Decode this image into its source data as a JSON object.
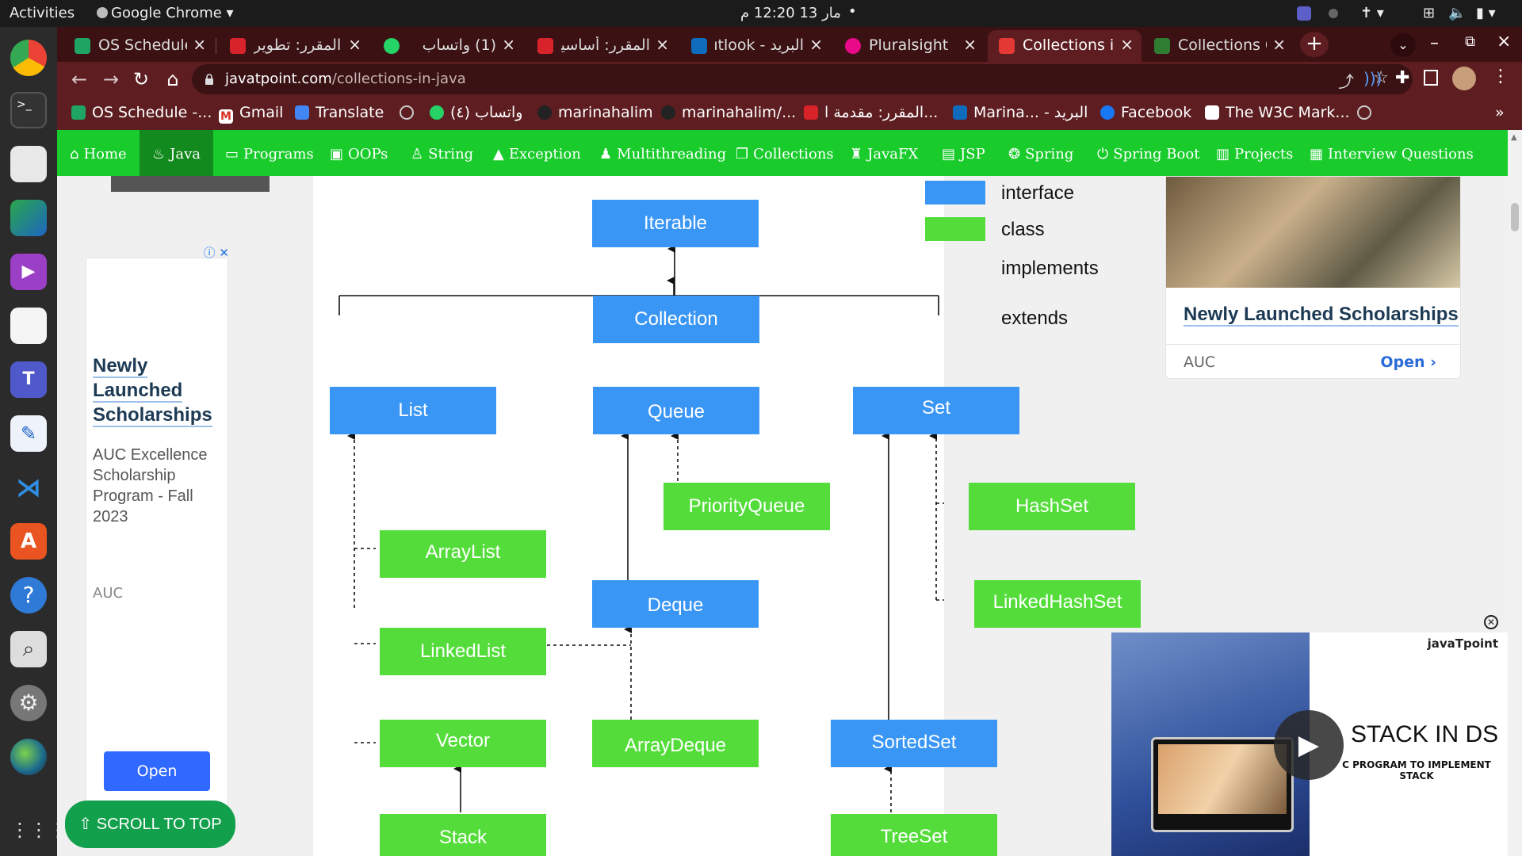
{
  "system": {
    "activities": "Activities",
    "app_name": "Google Chrome",
    "clock": "مار 13  12:20 م"
  },
  "browser": {
    "tabs": [
      {
        "title": "OS Schedule",
        "fav_color": "#1fa463"
      },
      {
        "title": "المقرر: تطوير",
        "fav_color": "#d8232a"
      },
      {
        "title": "(1) واتساب",
        "fav_color": "#25d366"
      },
      {
        "title": "المقرر: أساسيا",
        "fav_color": "#d8232a"
      },
      {
        "title": "البريد - Outlook",
        "fav_color": "#0f6cbd"
      },
      {
        "title": "Pluralsight",
        "fav_color": "#e80a89"
      },
      {
        "title": "Collections in",
        "fav_color": "#e53935"
      },
      {
        "title": "Collections Cl",
        "fav_color": "#2e7d32"
      }
    ],
    "new_tab_icon": "plus-icon",
    "url_domain": "javatpoint.com",
    "url_path": "/collections-in-java",
    "bookmarks": [
      "OS Schedule -...",
      "Gmail",
      "Translate",
      "",
      "واتساب (٤)",
      "marinahalim",
      "marinahalim/...",
      "المقرر: مقدمة ا...",
      "Marina... - البريد",
      "Facebook",
      "The W3C Mark..."
    ],
    "overflow": "»"
  },
  "site_nav": [
    {
      "label": "Home",
      "icon": "home-icon"
    },
    {
      "label": "Java",
      "icon": "java-icon"
    },
    {
      "label": "Programs",
      "icon": "monitor-icon"
    },
    {
      "label": "OOPs",
      "icon": "box-icon"
    },
    {
      "label": "String",
      "icon": "string-icon"
    },
    {
      "label": "Exception",
      "icon": "warning-icon"
    },
    {
      "label": "Multithreading",
      "icon": "thread-icon"
    },
    {
      "label": "Collections",
      "icon": "copy-icon"
    },
    {
      "label": "JavaFX",
      "icon": "fx-icon"
    },
    {
      "label": "JSP",
      "icon": "jsp-icon"
    },
    {
      "label": "Spring",
      "icon": "leaf-icon"
    },
    {
      "label": "Spring Boot",
      "icon": "power-icon"
    },
    {
      "label": "Projects",
      "icon": "folder-icon"
    },
    {
      "label": "Interview Questions",
      "icon": "question-icon"
    }
  ],
  "diagram": {
    "colors": {
      "interface": "#3a96f5",
      "class": "#54dd3a"
    },
    "legend": {
      "interface": "interface",
      "class": "class",
      "implements": "implements",
      "extends": "extends"
    },
    "nodes": {
      "iterable": "Iterable",
      "collection": "Collection",
      "list": "List",
      "queue": "Queue",
      "set": "Set",
      "priorityqueue": "PriorityQueue",
      "hashset": "HashSet",
      "arraylist": "ArrayList",
      "deque": "Deque",
      "linkedhashset": "LinkedHashSet",
      "linkedlist": "LinkedList",
      "vector": "Vector",
      "arraydeque": "ArrayDeque",
      "sortedset": "SortedSet",
      "stack": "Stack",
      "treeset": "TreeSet"
    }
  },
  "ads": {
    "left": {
      "title": "Newly Launched Scholarships",
      "description": "AUC Excellence Scholarship Program - Fall 2023",
      "brand": "AUC",
      "open": "Open"
    },
    "right": {
      "headline": "Newly Launched Scholarships",
      "brand": "AUC",
      "open": "Open"
    },
    "video": {
      "title": "STACK IN DS",
      "subtitle": "C PROGRAM TO IMPLEMENT STACK",
      "logo": "javaTpoint"
    }
  },
  "scroll_top": "⇧ SCROLL TO TOP"
}
